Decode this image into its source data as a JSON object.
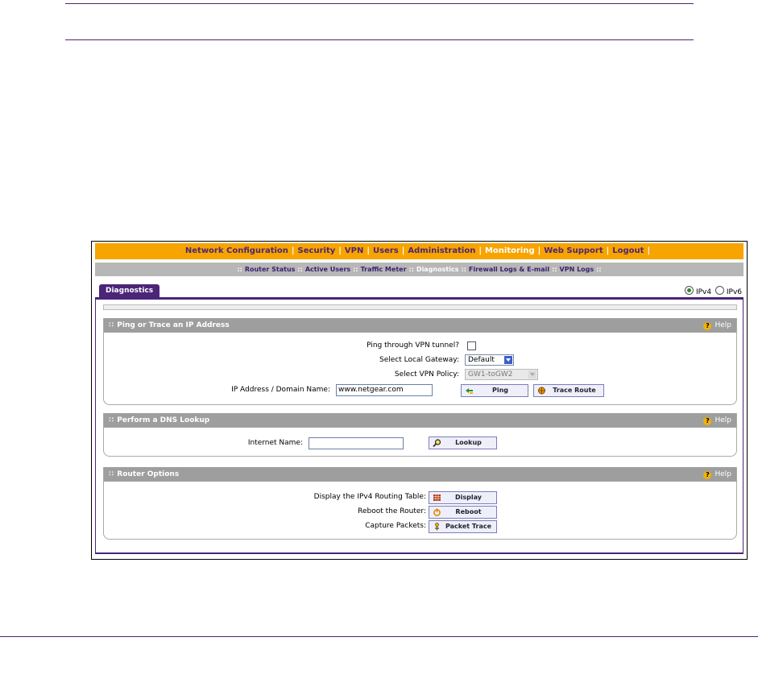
{
  "top_nav": [
    {
      "label": "Network Configuration",
      "active": false
    },
    {
      "label": "Security",
      "active": false
    },
    {
      "label": "VPN",
      "active": false
    },
    {
      "label": "Users",
      "active": false
    },
    {
      "label": "Administration",
      "active": false
    },
    {
      "label": "Monitoring",
      "active": true
    },
    {
      "label": "Web Support",
      "active": false
    },
    {
      "label": "Logout",
      "active": false
    }
  ],
  "nav_separator": "|",
  "sub_nav": [
    {
      "label": "Router Status",
      "active": false
    },
    {
      "label": "Active Users",
      "active": false
    },
    {
      "label": "Traffic Meter",
      "active": false
    },
    {
      "label": "Diagnostics",
      "active": true
    },
    {
      "label": "Firewall Logs & E-mail",
      "active": false
    },
    {
      "label": "VPN Logs",
      "active": false
    }
  ],
  "sub_separator": "::",
  "tab": {
    "label": "Diagnostics"
  },
  "ip_version": {
    "ipv4": "IPv4",
    "ipv6": "IPv6",
    "selected": "IPv4"
  },
  "help_label": "Help",
  "ping_section": {
    "title": "Ping or Trace an IP Address",
    "vpn_tunnel_label": "Ping through VPN tunnel?",
    "vpn_tunnel_checked": false,
    "gateway_label": "Select Local Gateway:",
    "gateway_value": "Default",
    "policy_label": "Select VPN Policy:",
    "policy_value": "GW1-toGW2",
    "ip_label": "IP Address / Domain Name:",
    "ip_value": "www.netgear.com",
    "ping_button": "Ping",
    "trace_button": "Trace Route"
  },
  "dns_section": {
    "title": "Perform a DNS Lookup",
    "name_label": "Internet Name:",
    "name_value": "",
    "lookup_button": "Lookup"
  },
  "router_section": {
    "title": "Router Options",
    "routing_label": "Display the IPv4 Routing Table:",
    "display_button": "Display",
    "reboot_label": "Reboot the Router:",
    "reboot_button": "Reboot",
    "capture_label": "Capture Packets:",
    "packet_button": "Packet Trace"
  },
  "colors": {
    "orange": "#f7a400",
    "purple": "#4b2578",
    "gray_bar": "#b7b7b7",
    "section_head": "#9e9e9e"
  }
}
